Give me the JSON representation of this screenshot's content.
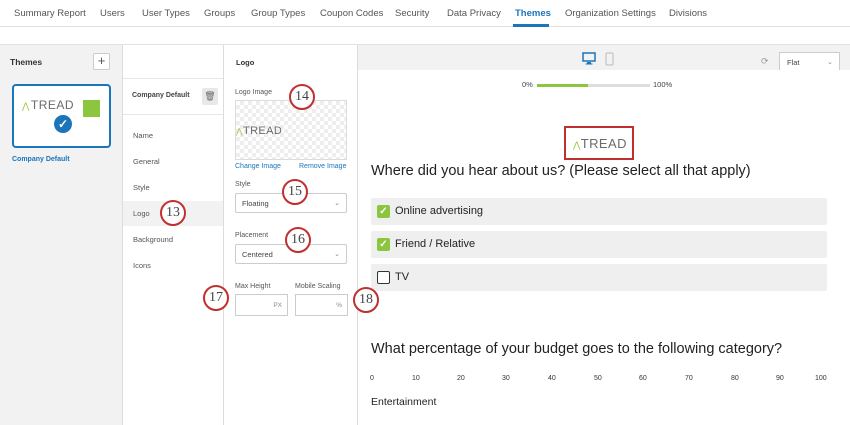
{
  "nav": {
    "tabs": [
      {
        "label": "Summary Report"
      },
      {
        "label": "Users"
      },
      {
        "label": "User Types"
      },
      {
        "label": "Groups"
      },
      {
        "label": "Group Types"
      },
      {
        "label": "Coupon Codes"
      },
      {
        "label": "Security"
      },
      {
        "label": "Data Privacy"
      },
      {
        "label": "Themes"
      },
      {
        "label": "Organization Settings"
      },
      {
        "label": "Divisions"
      }
    ],
    "active_tab": "Themes",
    "accent_color": "#1b75bb"
  },
  "themes_panel": {
    "title": "Themes",
    "add_icon": "plus-icon",
    "card": {
      "logo_text": "TREAD",
      "label": "Company Default",
      "selected_icon": "check-icon"
    }
  },
  "menu_panel": {
    "title": "Company Default",
    "delete_icon": "trash-icon",
    "items": [
      {
        "label": "Name"
      },
      {
        "label": "General"
      },
      {
        "label": "Style"
      },
      {
        "label": "Logo"
      },
      {
        "label": "Background"
      },
      {
        "label": "Icons"
      }
    ],
    "active_item": "Logo"
  },
  "logo_settings": {
    "title": "Logo",
    "logo_image_label": "Logo Image",
    "logo_text": "TREAD",
    "change_image": "Change Image",
    "remove_image": "Remove Image",
    "style_label": "Style",
    "style_value": "Floating",
    "placement_label": "Placement",
    "placement_value": "Centered",
    "max_height_label": "Max Height",
    "max_height_unit": "PX",
    "mobile_scaling_label": "Mobile Scaling",
    "mobile_scaling_unit": "%"
  },
  "preview": {
    "desktop_icon": "desktop-icon",
    "mobile_icon": "mobile-icon",
    "refresh_icon": "refresh-icon",
    "view_select": "Flat",
    "progress_start": "0%",
    "progress_end": "100%",
    "progress_fill": 0.45,
    "logo_text": "TREAD",
    "question1": "Where did you hear about us? (Please select all that apply)",
    "choices": [
      {
        "label": "Online advertising",
        "checked": true
      },
      {
        "label": "Friend / Relative",
        "checked": true
      },
      {
        "label": "TV",
        "checked": false
      }
    ],
    "question2": "What percentage of your budget goes to the following category?",
    "scale": [
      "0",
      "10",
      "20",
      "30",
      "40",
      "50",
      "60",
      "70",
      "80",
      "90",
      "100"
    ],
    "row_label": "Entertainment",
    "check_color": "#8cc63f"
  },
  "callouts": [
    "13",
    "14",
    "15",
    "16",
    "17",
    "18"
  ],
  "callout_color": "#c0302f"
}
